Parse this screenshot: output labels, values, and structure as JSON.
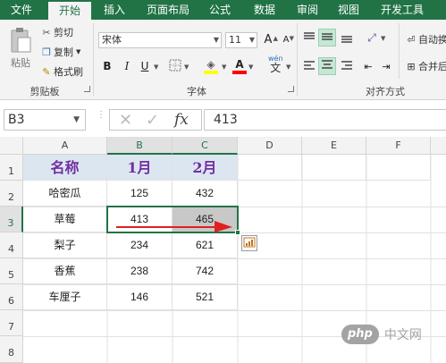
{
  "tabs": [
    {
      "label": "文件"
    },
    {
      "label": "开始"
    },
    {
      "label": "插入"
    },
    {
      "label": "页面布局"
    },
    {
      "label": "公式"
    },
    {
      "label": "数据"
    },
    {
      "label": "审阅"
    },
    {
      "label": "视图"
    },
    {
      "label": "开发工具"
    }
  ],
  "active_tab": "开始",
  "clipboard": {
    "paste": "粘贴",
    "cut": "剪切",
    "copy": "复制",
    "format_painter": "格式刷",
    "group": "剪贴板"
  },
  "font": {
    "name": "宋体",
    "size": "11",
    "bold": "B",
    "italic": "I",
    "underline": "U",
    "grow": "A",
    "shrink": "A",
    "font_color": "A",
    "wen": "wén",
    "wen_char": "文",
    "group": "字体",
    "highlight_color": "#ffff00",
    "font_color_hex": "#ff0000"
  },
  "alignment": {
    "wrap": "自动换",
    "merge": "合并后",
    "group": "对齐方式"
  },
  "formula_bar": {
    "name_box": "B3",
    "cancel": "✕",
    "enter": "✓",
    "fx": "fx",
    "value": "413"
  },
  "columns": [
    "A",
    "B",
    "C",
    "D",
    "E",
    "F"
  ],
  "rows": [
    "1",
    "2",
    "3",
    "4",
    "5",
    "6",
    "7",
    "8"
  ],
  "table": {
    "header": [
      "名称",
      "1月",
      "2月"
    ],
    "data": [
      [
        "哈密瓜",
        "125",
        "432"
      ],
      [
        "草莓",
        "413",
        "465"
      ],
      [
        "梨子",
        "234",
        "621"
      ],
      [
        "香蕉",
        "238",
        "742"
      ],
      [
        "车厘子",
        "146",
        "521"
      ]
    ]
  },
  "watermark": {
    "brand": "php",
    "text": "中文网"
  },
  "colors": {
    "accent": "#217346",
    "header_fill": "#dce6f1",
    "header_text": "#7030a0",
    "arrow": "#e02020"
  }
}
